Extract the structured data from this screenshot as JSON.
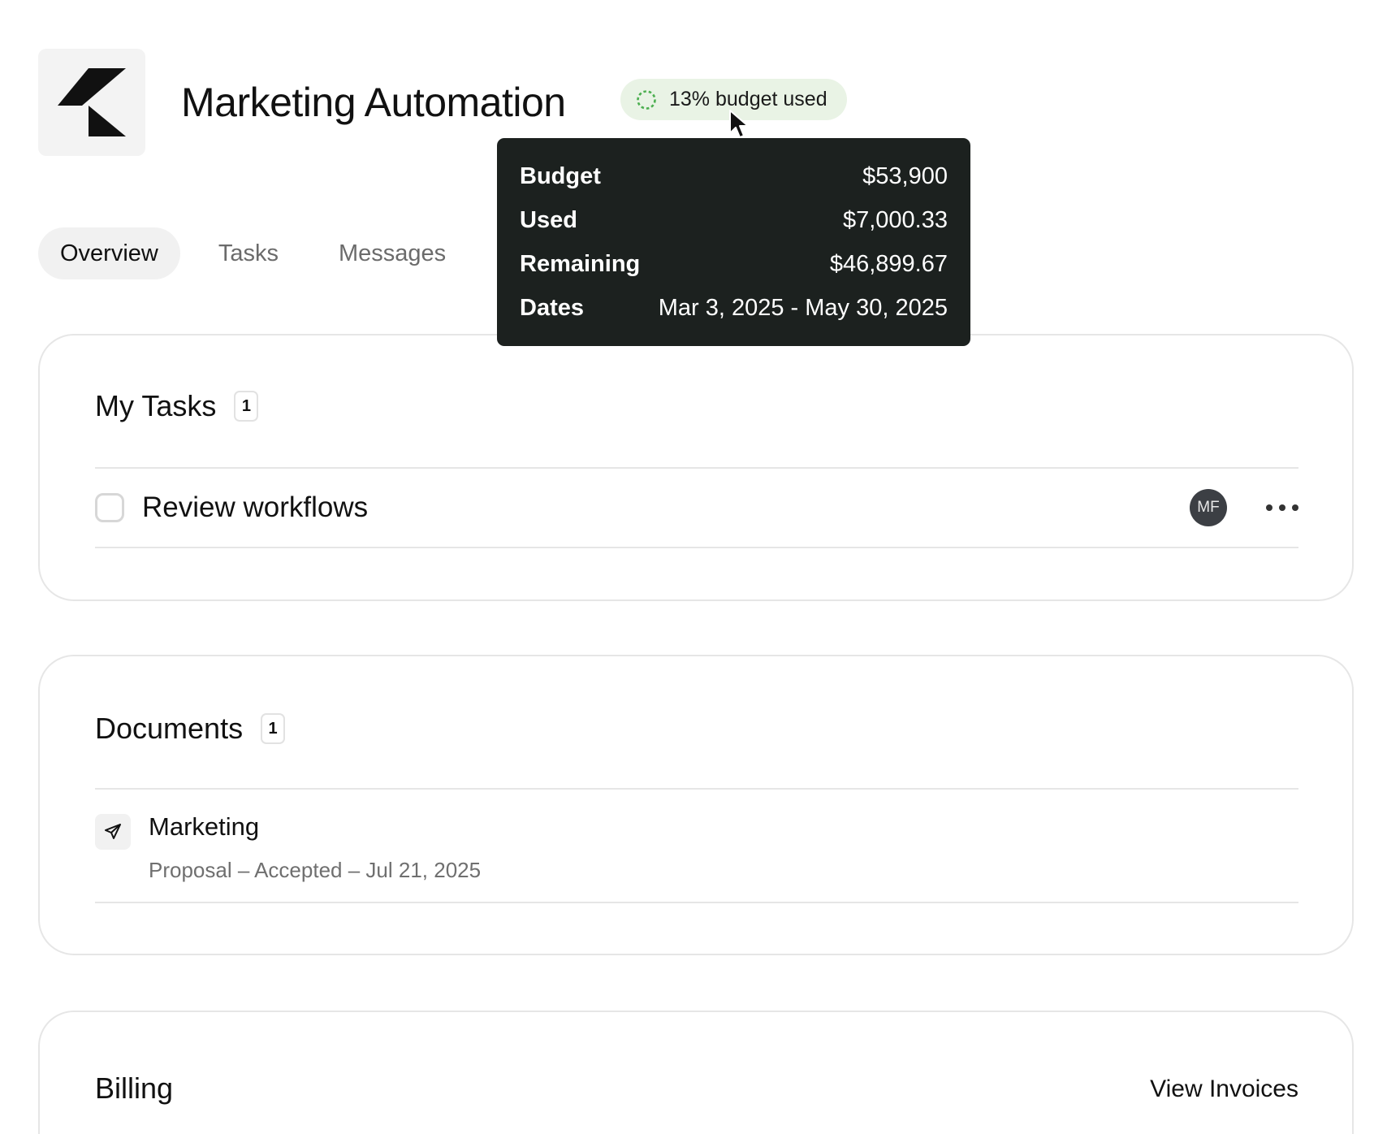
{
  "header": {
    "title": "Marketing Automation",
    "logo_icon": "brand-logo-icon",
    "budget_badge": {
      "text": "13% budget used",
      "percent_used": 13,
      "accent_color": "#4caf50"
    }
  },
  "budget_tooltip": {
    "rows": [
      {
        "label": "Budget",
        "value": "$53,900"
      },
      {
        "label": "Used",
        "value": "$7,000.33"
      },
      {
        "label": "Remaining",
        "value": "$46,899.67"
      },
      {
        "label": "Dates",
        "value": "Mar 3, 2025 - May 30, 2025"
      }
    ]
  },
  "tabs": [
    {
      "label": "Overview",
      "active": true
    },
    {
      "label": "Tasks",
      "active": false
    },
    {
      "label": "Messages",
      "active": false
    }
  ],
  "my_tasks": {
    "title": "My Tasks",
    "count": "1",
    "items": [
      {
        "name": "Review workflows",
        "assignee_initials": "MF",
        "checked": false
      }
    ]
  },
  "documents": {
    "title": "Documents",
    "count": "1",
    "items": [
      {
        "title": "Marketing",
        "meta": "Proposal – Accepted – Jul 21, 2025",
        "icon": "send-icon"
      }
    ]
  },
  "billing": {
    "title": "Billing",
    "view_invoices_label": "View Invoices"
  }
}
